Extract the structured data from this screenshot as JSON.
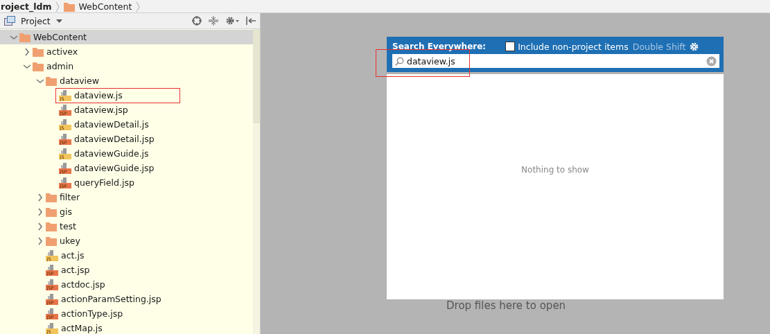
{
  "breadcrumbs": [
    {
      "label": "roject_ldm",
      "kind": "project"
    },
    {
      "label": "WebContent",
      "kind": "folder"
    }
  ],
  "panel": {
    "title": "Project"
  },
  "tree": [
    {
      "label": "WebContent",
      "kind": "folder",
      "expanded": true,
      "selected": true,
      "highlighted": false,
      "children": [
        {
          "label": "activex",
          "kind": "folder",
          "expanded": false,
          "selected": false,
          "highlighted": false
        },
        {
          "label": "admin",
          "kind": "folder",
          "expanded": true,
          "selected": false,
          "highlighted": false,
          "children": [
            {
              "label": "dataview",
              "kind": "folder",
              "expanded": true,
              "selected": false,
              "highlighted": false,
              "children": [
                {
                  "label": "dataview.js",
                  "kind": "js",
                  "badge": "JS",
                  "selected": false,
                  "highlighted": true
                },
                {
                  "label": "dataview.jsp",
                  "kind": "jsp",
                  "badge": "JSP",
                  "selected": false,
                  "highlighted": false
                },
                {
                  "label": "dataviewDetail.js",
                  "kind": "js",
                  "badge": "JS",
                  "selected": false,
                  "highlighted": false
                },
                {
                  "label": "dataviewDetail.jsp",
                  "kind": "jsp",
                  "badge": "JSP",
                  "selected": false,
                  "highlighted": false
                },
                {
                  "label": "dataviewGuide.js",
                  "kind": "js",
                  "badge": "JS",
                  "selected": false,
                  "highlighted": false
                },
                {
                  "label": "dataviewGuide.jsp",
                  "kind": "jsp",
                  "badge": "JSP",
                  "selected": false,
                  "highlighted": false
                },
                {
                  "label": "queryField.jsp",
                  "kind": "jsp",
                  "badge": "JSP",
                  "selected": false,
                  "highlighted": false
                }
              ]
            },
            {
              "label": "filter",
              "kind": "folder",
              "expanded": false,
              "selected": false,
              "highlighted": false
            },
            {
              "label": "gis",
              "kind": "folder",
              "expanded": false,
              "selected": false,
              "highlighted": false
            },
            {
              "label": "test",
              "kind": "folder",
              "expanded": false,
              "selected": false,
              "highlighted": false
            },
            {
              "label": "ukey",
              "kind": "folder",
              "expanded": false,
              "selected": false,
              "highlighted": false
            },
            {
              "label": "act.js",
              "kind": "js",
              "badge": "JS",
              "selected": false,
              "highlighted": false
            },
            {
              "label": "act.jsp",
              "kind": "jsp",
              "badge": "JSP",
              "selected": false,
              "highlighted": false
            },
            {
              "label": "actdoc.jsp",
              "kind": "jsp",
              "badge": "JSP",
              "selected": false,
              "highlighted": false
            },
            {
              "label": "actionParamSetting.jsp",
              "kind": "jsp",
              "badge": "JSP",
              "selected": false,
              "highlighted": false
            },
            {
              "label": "actionType.jsp",
              "kind": "jsp",
              "badge": "JSP",
              "selected": false,
              "highlighted": false
            },
            {
              "label": "actMap.js",
              "kind": "js",
              "badge": "JS",
              "selected": false,
              "highlighted": false
            }
          ]
        }
      ]
    }
  ],
  "search": {
    "title": "Search Everywhere:",
    "include_label": "Include non-project items",
    "include_checked": false,
    "shortcut": "Double Shift",
    "value": "dataview.js",
    "highlighted": true,
    "empty_text": "Nothing to show"
  },
  "editor": {
    "hint": "Drop files here to open"
  }
}
